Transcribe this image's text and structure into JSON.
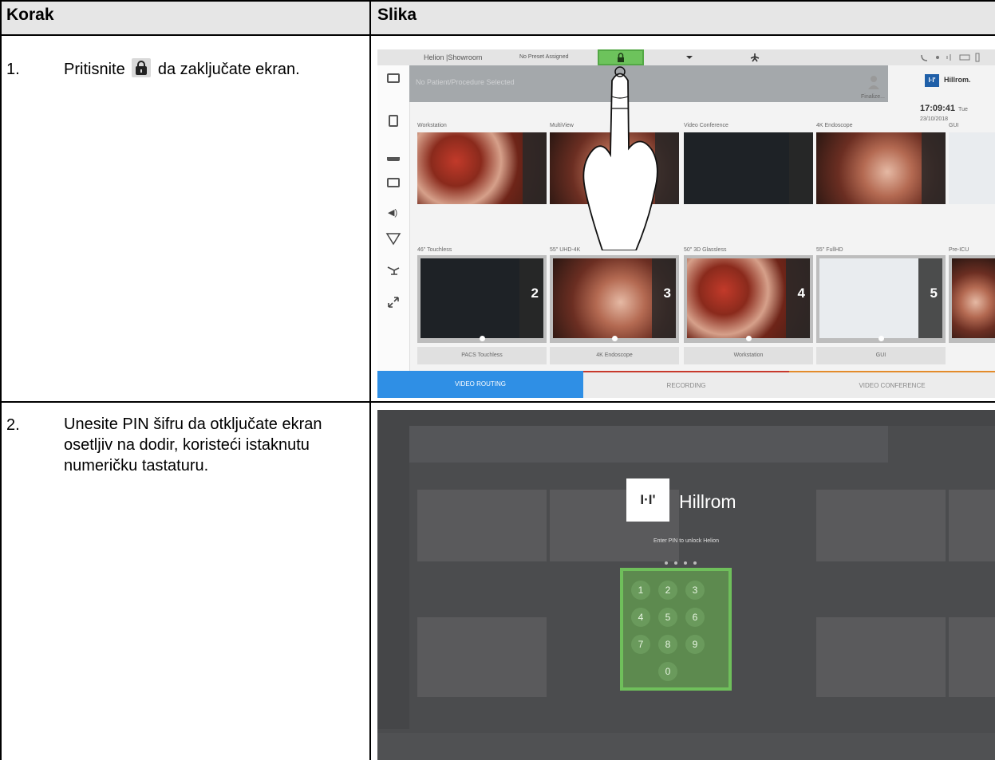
{
  "table": {
    "header": {
      "col_step": "Korak",
      "col_image": "Slika"
    },
    "rows": [
      {
        "num": "1.",
        "text_before": "Pritisnite",
        "text_after": "da zaključate ekran.",
        "icon": "lock-icon"
      },
      {
        "num": "2.",
        "text": "Unesite PIN šifru da otključate ekran osetljiv na dodir, koristeći istaknutu numeričku tastaturu."
      }
    ]
  },
  "screen1": {
    "topbar": {
      "room": "Helion |Showroom",
      "preset": "No Preset Assigned"
    },
    "info_bar": "No Patient/Procedure Selected",
    "finalize": "Finalize...",
    "brand": "Hillrom.",
    "time": "17:09:41",
    "date": "Tue 23/10/2018",
    "sources": [
      "Workstation",
      "MultiView",
      "Video Conference",
      "4K Endoscope",
      "GUI"
    ],
    "destinations": [
      "46\" Touchless",
      "55\" UHD-4K",
      "50\" 3D Glassless",
      "55\" FullHD",
      "Pre-ICU"
    ],
    "dest_numbers": [
      "2",
      "3",
      "4",
      "5"
    ],
    "dest_inputs": [
      "PACS Touchless",
      "4K Endoscope",
      "Workstation",
      "GUI"
    ],
    "tabs": [
      "VIDEO ROUTING",
      "RECORDING",
      "VIDEO CONFERENCE"
    ],
    "accent": "#2f8fe5",
    "highlight": "#6dc35c"
  },
  "screen2": {
    "logo_mark": "I·I'",
    "brand": "Hillrom",
    "prompt": "Enter PIN to unlock Helion",
    "keys": [
      "1",
      "2",
      "3",
      "4",
      "5",
      "6",
      "7",
      "8",
      "9",
      "0"
    ],
    "highlight": "#6fbf5b"
  }
}
